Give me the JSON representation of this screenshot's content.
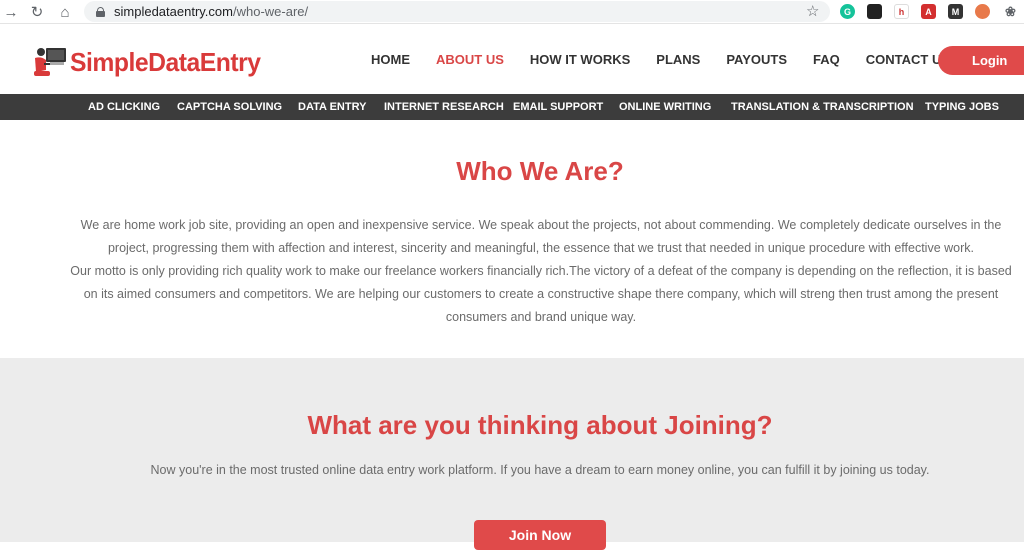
{
  "browser": {
    "url_domain": "simpledataentry.com",
    "url_path": "/who-we-are/"
  },
  "logo": {
    "text": "SimpleDataEntry"
  },
  "nav": {
    "home": "HOME",
    "about": "ABOUT US",
    "how": "HOW IT WORKS",
    "plans": "PLANS",
    "payouts": "PAYOUTS",
    "faq": "FAQ",
    "contact": "CONTACT US",
    "login": "Login"
  },
  "subnav": {
    "ad_clicking": "AD CLICKING",
    "captcha": "CAPTCHA SOLVING",
    "data_entry": "DATA ENTRY",
    "research": "INTERNET RESEARCH",
    "email": "EMAIL SUPPORT",
    "writing": "ONLINE WRITING",
    "translation": "TRANSLATION & TRANSCRIPTION",
    "typing": "TYPING JOBS"
  },
  "who": {
    "title": "Who We Are?",
    "para1": "We are home work job site, providing an open and inexpensive service. We speak about the projects, not about commending. We completely dedicate ourselves in the project, progressing them with affection and interest, sincerity and meaningful, the essence that we trust that needed in unique procedure with effective work.",
    "para2": "Our motto is only providing rich quality work to make our freelance workers financially rich.The victory of a defeat of the company is depending on the reflection, it is based on its aimed consumers and competitors. We are helping our customers to create a constructive shape there company, which will streng then trust among the present consumers and brand unique way."
  },
  "join": {
    "title": "What are you thinking about Joining?",
    "text": "Now you're in the most trusted online data entry work platform. If you have a dream to earn money online, you can fulfill it by joining us today.",
    "button": "Join Now"
  },
  "colors": {
    "accent": "#e04a4a",
    "nav_dark": "#3c3c3c",
    "heading": "#d94646"
  }
}
